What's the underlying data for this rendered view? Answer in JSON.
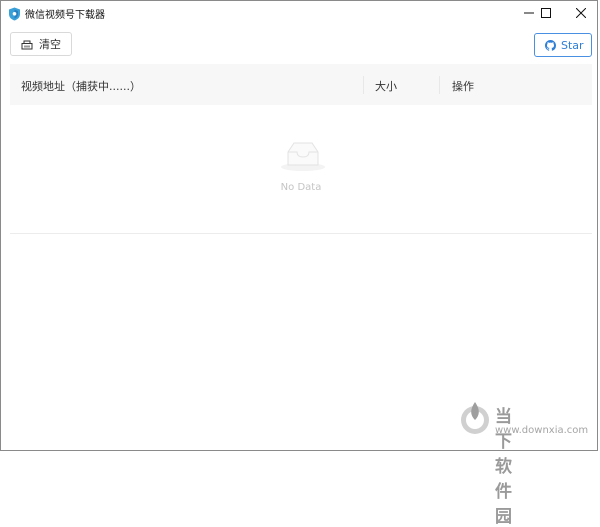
{
  "window": {
    "title": "微信视频号下载器",
    "controls": [
      "minimize",
      "maximize",
      "close"
    ]
  },
  "toolbar": {
    "clear_label": "清空",
    "clear_icon": "clear-icon",
    "star_label": "Star",
    "star_icon": "github-icon",
    "accent": "#2f7fd6"
  },
  "table": {
    "columns": [
      "视频地址（捕获中......）",
      "大小",
      "操作"
    ],
    "rows": [],
    "empty_text": "No Data"
  },
  "watermark": {
    "title": "当下软件园",
    "url": "www.downxia.com"
  }
}
